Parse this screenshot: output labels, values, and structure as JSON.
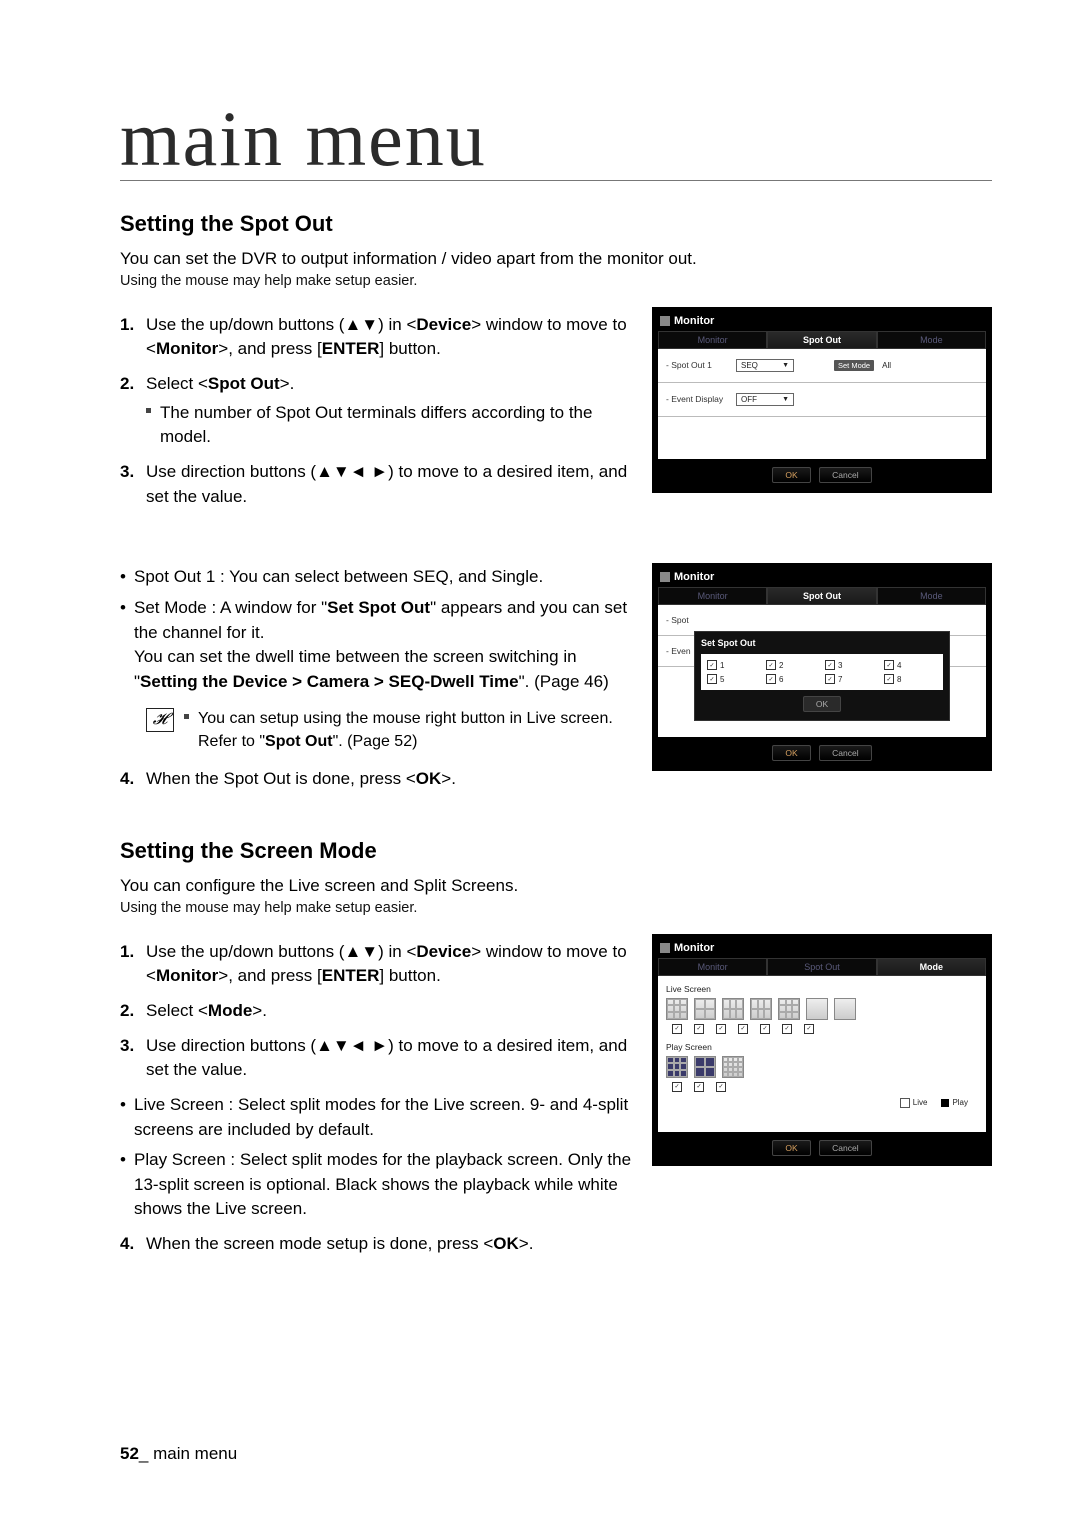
{
  "chapter": "main menu",
  "section1": {
    "title": "Setting the Spot Out",
    "intro": "You can set the DVR to output information / video apart from the monitor out.",
    "mouse_note": "Using the mouse may help make setup easier.",
    "step1_pre": "Use the up/down buttons (▲▼) in <",
    "step1_dev": "Device",
    "step1_mid": "> window to move to <",
    "step1_mon": "Monitor",
    "step1_post1": ">, and press [",
    "step1_enter": "ENTER",
    "step1_post2": "] button.",
    "step2_pre": "Select <",
    "step2_spot": "Spot Out",
    "step2_post": ">.",
    "step2_sub": "The number of Spot Out terminals differs according to the model.",
    "step3": "Use direction buttons (▲▼◄ ►) to move to a desired item, and set the value.",
    "bullet1": "Spot Out 1 : You can select between SEQ, and Single.",
    "bullet2_pre": "Set Mode : A window for \"",
    "bullet2_bold": "Set Spot Out",
    "bullet2_post": "\" appears and you can set the channel for it.",
    "bullet2_line2_pre": "You can set the dwell time between the screen switching in \"",
    "bullet2_line2_bold": "Setting the Device > Camera > SEQ-Dwell Time",
    "bullet2_line2_post": "\". (Page 46)",
    "note_line1": "You can setup using the mouse right button in Live screen.",
    "note_line2_pre": "Refer to \"",
    "note_line2_bold": "Spot Out",
    "note_line2_post": "\". (Page 52)",
    "step4_pre": "When the Spot Out is done, press <",
    "step4_ok": "OK",
    "step4_post": ">."
  },
  "dlg": {
    "title": "Monitor",
    "tabs": {
      "monitor": "Monitor",
      "spotout": "Spot Out",
      "mode": "Mode"
    },
    "row1_label": "- Spot Out 1",
    "row1_value": "SEQ",
    "setmode": "Set Mode",
    "all": "All",
    "row2_label": "- Event Display",
    "row2_value": "OFF",
    "ok": "OK",
    "cancel": "Cancel",
    "popup_title": "Set Spot Out",
    "n1": "1",
    "n2": "2",
    "n3": "3",
    "n4": "4",
    "n5": "5",
    "n6": "6",
    "n7": "7",
    "n8": "8",
    "spot_side": "- Spot",
    "even_side": "- Even"
  },
  "section2": {
    "title": "Setting the Screen Mode",
    "intro": "You can configure the Live screen and Split Screens.",
    "mouse_note": "Using the mouse may help make setup easier.",
    "step2_pre": "Select <",
    "step2_mode": "Mode",
    "step2_post": ">.",
    "bullet_live": "Live Screen : Select split modes for the Live screen. 9- and 4-split screens are included by default.",
    "bullet_play": "Play Screen : Select split modes for the playback screen. Only the 13-split screen is optional. Black shows the playback while white shows the Live screen.",
    "step4_pre": "When the screen mode setup is done, press <",
    "step4_ok": "OK",
    "step4_post": ">."
  },
  "dlg_mode": {
    "live_label": "Live Screen",
    "play_label": "Play Screen",
    "legend_live": "Live",
    "legend_play": "Play"
  },
  "footer": {
    "page": "52",
    "sep": "_ ",
    "label": "main menu"
  }
}
